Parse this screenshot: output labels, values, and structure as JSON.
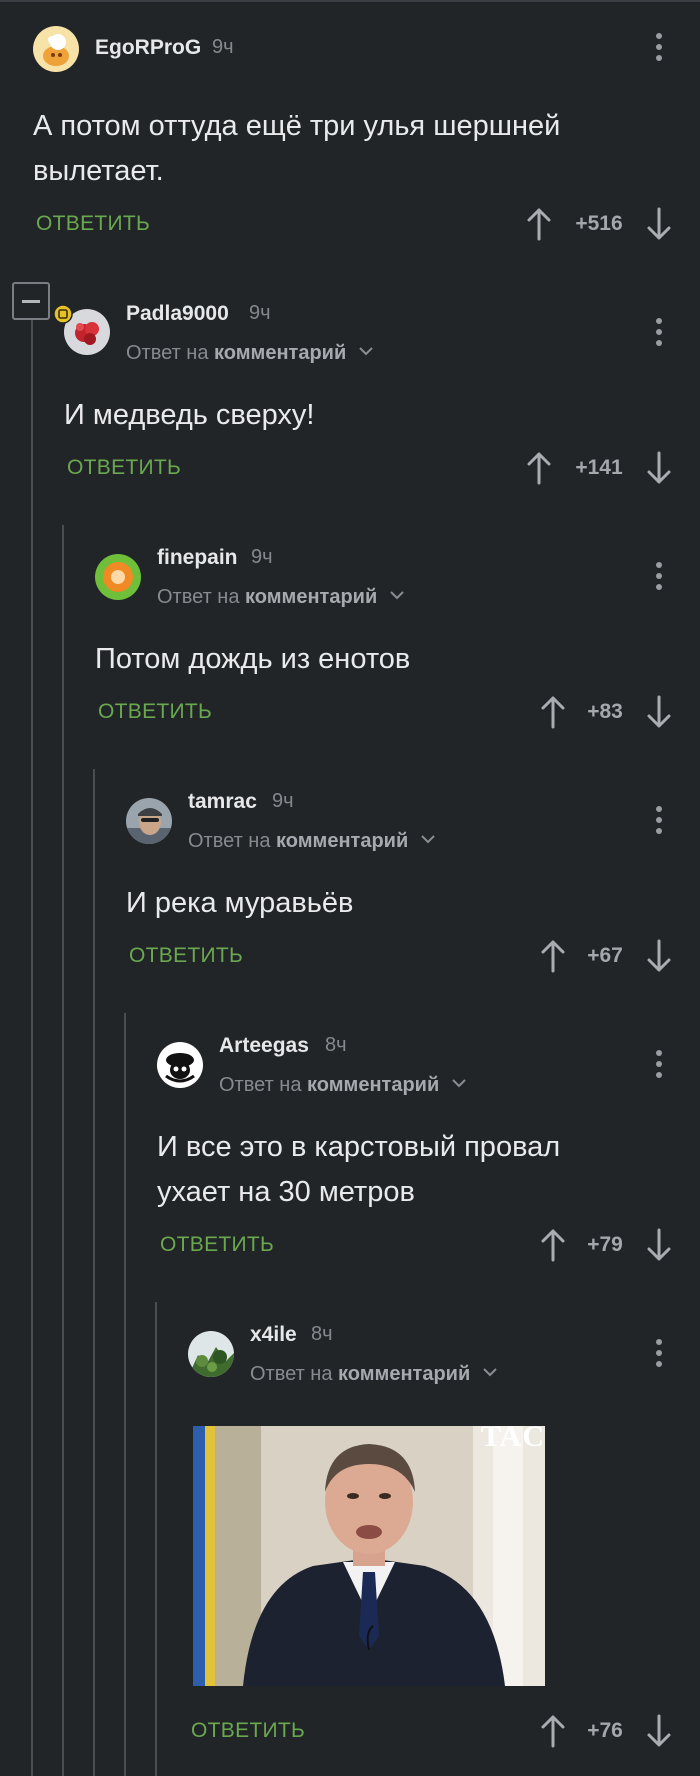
{
  "labels": {
    "reply_to_prefix": "Ответ на",
    "reply_to_target": "комментарий",
    "reply_button": "ОТВЕТИТЬ"
  },
  "icons": [
    "minus-icon",
    "chevron-down-icon",
    "more-vertical-icon",
    "arrow-up-icon",
    "arrow-down-icon",
    "badge-icon"
  ],
  "colors": {
    "background": "#222528",
    "accent_green": "#6aa84f",
    "thread_line": "#4a4d52"
  },
  "comments": [
    {
      "author": "EgoRProG",
      "time": "9ч",
      "text_lines": [
        "А потом оттуда ещё три улья шершней",
        "вылетает."
      ],
      "score": "+516"
    },
    {
      "author": "Padla9000",
      "time": "9ч",
      "text_lines": [
        "И медведь сверху!"
      ],
      "score": "+141"
    },
    {
      "author": "finepain",
      "time": "9ч",
      "text_lines": [
        "Потом дождь из енотов"
      ],
      "score": "+83"
    },
    {
      "author": "tamrac",
      "time": "9ч",
      "text_lines": [
        "И река муравьёв"
      ],
      "score": "+67"
    },
    {
      "author": "Arteegas",
      "time": "8ч",
      "text_lines": [
        "И все это в карстовый провал",
        "ухает на 30 метров"
      ],
      "score": "+79"
    },
    {
      "author": "x4ile",
      "time": "8ч",
      "text_lines": [],
      "score": "+76",
      "gif_watermark": "TAC"
    }
  ]
}
